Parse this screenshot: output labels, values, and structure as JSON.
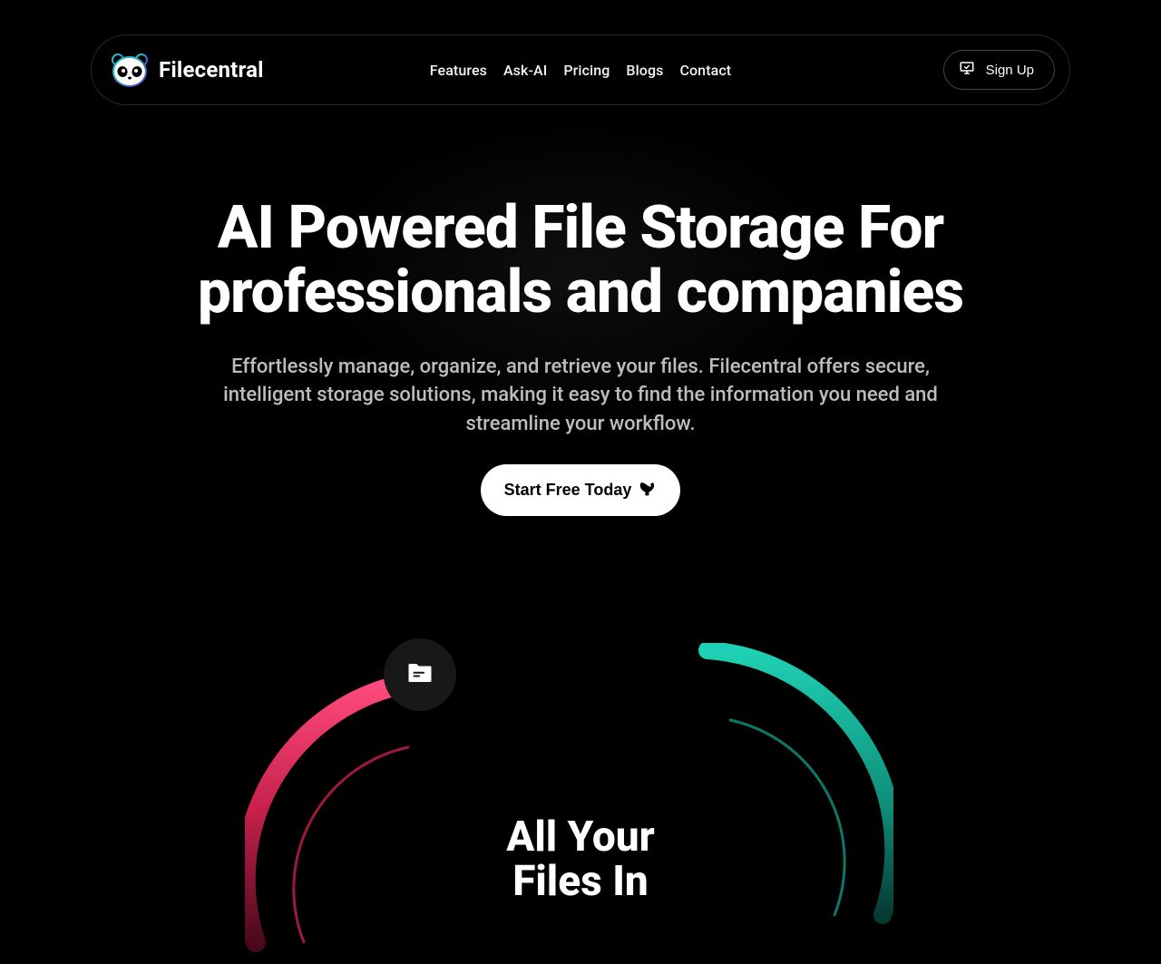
{
  "brand": "Filecentral",
  "nav": {
    "items": [
      "Features",
      "Ask-AI",
      "Pricing",
      "Blogs",
      "Contact"
    ]
  },
  "signup_label": "Sign Up",
  "hero": {
    "title_line1": "AI Powered File Storage For",
    "title_line2": "professionals and companies",
    "subtitle": "Effortlessly manage, organize, and retrieve your files. Filecentral offers secure, intelligent storage solutions, making it easy to find the information you need and streamline your workflow.",
    "cta_label": "Start Free Today"
  },
  "below": {
    "heading_line1": "All Your",
    "heading_line2": "Files In"
  },
  "colors": {
    "pink": "#d7325b",
    "teal": "#10b8a0"
  }
}
